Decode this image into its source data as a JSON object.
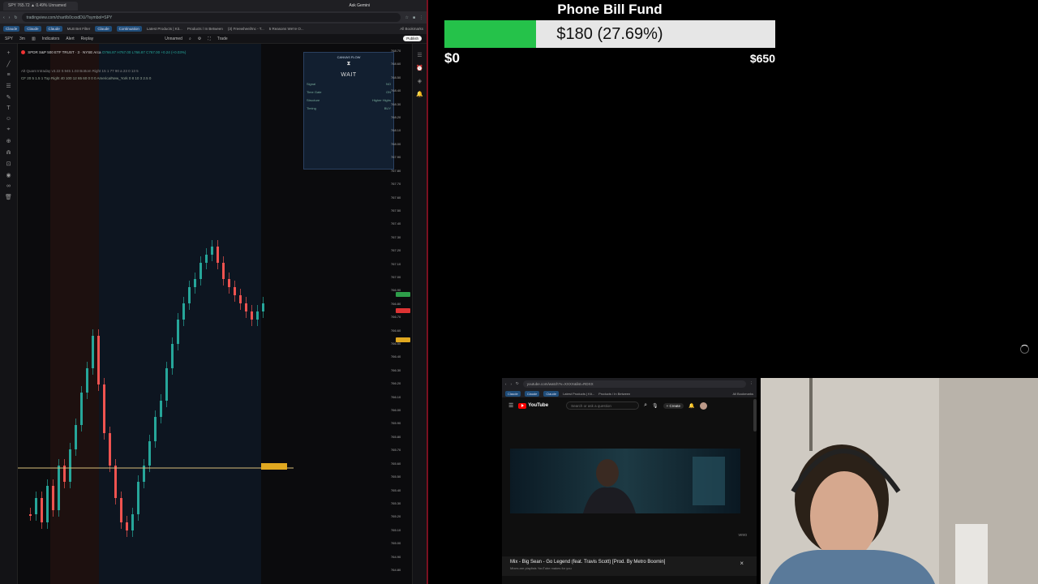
{
  "tradingview": {
    "tab_title": "SPY 765.72 ▲ 0.49% Unnamed",
    "ask_label": "Ask Gemini",
    "url": "tradingview.com/chart/b0cxxdDU/?symbol=SPY",
    "bookmarks": [
      "Claude",
      "Claude",
      "Claude",
      "MLB Bet Filter",
      "Claude",
      "Continuation",
      "Latest Products | Kit...",
      "Products / In Between",
      "(3) Freewheel/Inc - T...",
      "5 Reasons We're O...",
      "All Bookmarks"
    ],
    "toolbar": {
      "symbol": "SPY",
      "interval": "3m",
      "indicators": "Indicators",
      "alert": "Alert",
      "replay": "Replay",
      "layout_name": "Unnamed",
      "trade": "Trade",
      "publish": "Publish"
    },
    "legend": {
      "title": "SPDR S&P 500 ETF TRUST · 3 · NYSE Arca",
      "ohlc": "O766.87 H767.00 L766.87 C767.00 +0.24 (+0.03%)",
      "indicator1": "Alt Quant Intraday v3.22 0.945 1.03 Bottom Right 15 1 77 90 a 23 0 13 5",
      "indicator2": "CF 20 5 1.5 1 Top Right 40 100 12 65 60 0 0 0 America/New_York 0 8 10 3 2.5 0"
    },
    "price_axis": [
      "768.70",
      "768.60",
      "768.50",
      "768.40",
      "768.30",
      "768.20",
      "768.10",
      "768.00",
      "767.90",
      "767.80",
      "767.70",
      "767.60",
      "767.50",
      "767.40",
      "767.30",
      "767.20",
      "767.10",
      "767.00",
      "766.90",
      "766.80",
      "766.70",
      "766.60",
      "766.50",
      "766.40",
      "766.30",
      "766.20",
      "766.10",
      "766.00",
      "765.90",
      "765.80",
      "765.70",
      "765.60",
      "765.50",
      "765.40",
      "765.30",
      "765.20",
      "765.10",
      "765.00",
      "764.90",
      "764.80"
    ],
    "flow_panel": {
      "title": "CANVAS FLOW",
      "status": "WAIT",
      "rows": [
        [
          "Signal",
          "NO"
        ],
        [
          "Time Gate",
          "ON"
        ],
        [
          "Structure",
          "Higher Highs"
        ],
        [
          "Timing",
          "BUY"
        ]
      ]
    }
  },
  "fund": {
    "title": "Phone Bill Fund",
    "amount_text": "$180 (27.69%)",
    "progress": 0.2769,
    "min_label": "$0",
    "max_label": "$650",
    "fill_color": "#25c24a"
  },
  "youtube": {
    "url": "youtube.com/watch?v=XXXX&list=RDXX",
    "bookmarks": [
      "Claude",
      "Claude",
      "Claude",
      "Latest Products | Kit...",
      "Products / In Between",
      "All Bookmarks"
    ],
    "logo": "YouTube",
    "search_placeholder": "Search or ask a question",
    "create_label": "Create",
    "vevo": "vevo",
    "mix_title": "Mix - Big Sean - Go Legend (feat. Travis Scott) [Prod. By Metro Boomin]",
    "mix_sub": "Mixes are playlists YouTube makes for you"
  }
}
